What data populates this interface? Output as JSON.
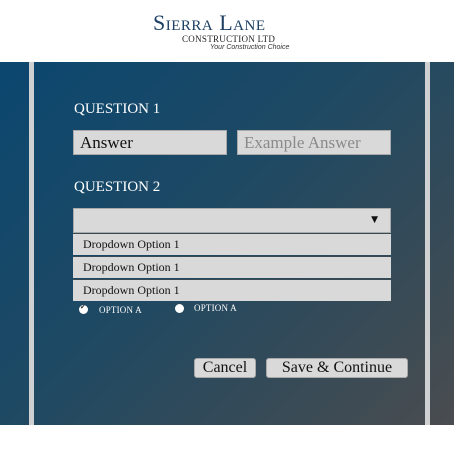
{
  "brand": {
    "name": "Sierra Lane",
    "subtitle": "CONSTRUCTION LTD",
    "tagline": "Your Construction Choice"
  },
  "form": {
    "question1": {
      "label": "QUESTION 1",
      "answer_value": "Answer",
      "example_placeholder": "Example Answer"
    },
    "question2": {
      "label": "QUESTION 2",
      "selected_value": "",
      "options": [
        "Dropdown Option 1",
        "Dropdown Option 1",
        "Dropdown Option 1"
      ]
    },
    "radios": [
      {
        "label": "OPTION A",
        "checked": true
      },
      {
        "label": "OPTION A",
        "checked": false
      }
    ],
    "buttons": {
      "cancel": "Cancel",
      "save_continue": "Save & Continue"
    }
  },
  "colors": {
    "panel_gradient_start": "#0b4770",
    "panel_gradient_end": "#4a4c50",
    "brand_blue": "#1d3f63",
    "field_bg": "#d9d9d9"
  }
}
